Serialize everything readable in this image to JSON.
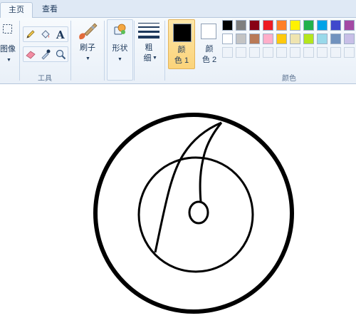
{
  "tabs": [
    {
      "label": "主页",
      "active": true
    },
    {
      "label": "查看",
      "active": false
    }
  ],
  "ribbon": {
    "image_group": {
      "label": "图像"
    },
    "tools_group": {
      "label": "工具"
    },
    "brushes": {
      "label": "刷子"
    },
    "shapes": {
      "label": "形状"
    },
    "size": {
      "label_line1": "粗",
      "label_line2": "细"
    },
    "color1": {
      "label_line1": "颜",
      "label_line2": "色 1",
      "value": "#000000"
    },
    "color2": {
      "label_line1": "颜",
      "label_line2": "色 2",
      "value": "#ffffff"
    },
    "colors_group": {
      "label": "颜色"
    },
    "palette_row1": [
      "#000000",
      "#7f7f7f",
      "#880015",
      "#ed1c24",
      "#ff7f27",
      "#fff200",
      "#22b14c",
      "#00a2e8",
      "#3f48cc",
      "#a349a4"
    ],
    "palette_row2": [
      "#ffffff",
      "#c3c3c3",
      "#b97a57",
      "#ffaec9",
      "#ffc90e",
      "#efe4b0",
      "#b5e61d",
      "#99d9ea",
      "#7092be",
      "#c8bfe7"
    ]
  },
  "icons": [
    "select-icon",
    "pencil-icon",
    "fill-icon",
    "text-icon",
    "eraser-icon",
    "color-picker-icon",
    "magnifier-icon",
    "brush-icon",
    "shapes-icon",
    "line-size-icon"
  ]
}
